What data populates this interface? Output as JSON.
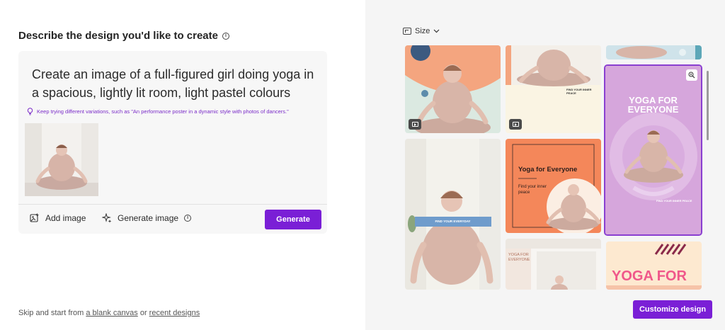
{
  "left": {
    "heading": "Describe the design you'd like to create",
    "prompt": "Create an image of a full-figured girl doing yoga in a spacious, lightly lit room, light pastel colours",
    "tip": "Keep trying different variations, such as \"An performance poster in a dynamic style with photos of dancers.\"",
    "add_image_label": "Add image",
    "generate_image_label": "Generate image",
    "generate_button": "Generate",
    "skip_prefix": "Skip and start from ",
    "blank_canvas_link": "a blank canvas",
    "or_text": " or ",
    "recent_designs_link": "recent designs"
  },
  "right": {
    "size_label": "Size",
    "customize_button": "Customize design",
    "cards": {
      "card3_caption": "FIND YOUR INNER PEACE",
      "card5_banner": "FIND YOUR EVERYDAY",
      "card6_title": "Yoga for Everyone",
      "card6_sub": "Find your inner peace",
      "card4_title_1": "YOGA FOR",
      "card4_title_2": "EVERYONE",
      "card4_caption": "FIND YOUR INNER PEACE",
      "card7_title_1": "YOGA FOR",
      "card7_title_2": "EVERYONE",
      "card8_title": "YOGA FOR"
    }
  },
  "colors": {
    "accent": "#7a1fd6",
    "tip_text": "#7a2bc8",
    "selected_border": "#8a3fd0"
  }
}
